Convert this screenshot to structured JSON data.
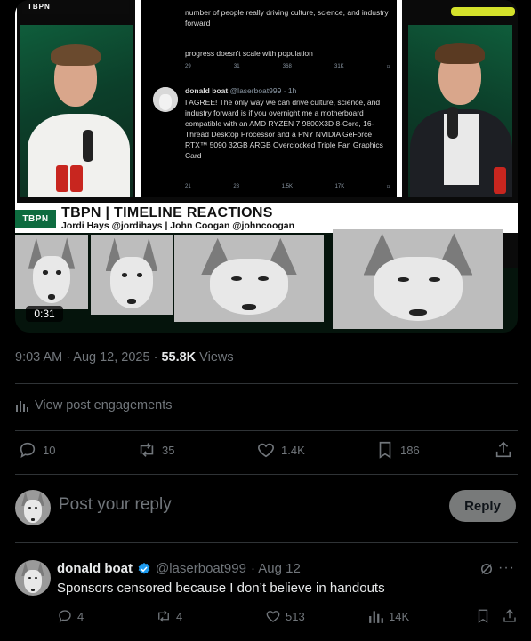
{
  "video": {
    "overlay_tag": "TBPN",
    "embedded_tweet": {
      "top_text": "number of people really driving culture, science, and industry forward",
      "second_line": "progress doesn't scale with population",
      "first_counts": {
        "replies": "29",
        "reposts": "31",
        "likes": "368",
        "views": "31K"
      },
      "author": "donald boat",
      "handle": "@laserboat999 · 1h",
      "body": "I AGREE! The only way we can drive culture, science, and industry forward is if you overnight me a motherboard compatible with an AMD RYZEN 7 9800X3D 8-Core, 16-Thread Desktop Processor and a PNY NVIDIA GeForce RTX™ 5090 32GB ARGB Overclocked Triple Fan Graphics Card",
      "counts": {
        "replies": "21",
        "reposts": "28",
        "likes": "1.5K",
        "views": "17K"
      }
    },
    "lower_third": {
      "logo": "TBPN",
      "title": "TBPN | TIMELINE REACTIONS",
      "subtitle": "Jordi Hays @jordihays | John Coogan @johncoogan"
    },
    "duration": "0:31"
  },
  "post_meta": {
    "time": "9:03 AM · Aug 12, 2025 · ",
    "views_count": "55.8K",
    "views_label": " Views"
  },
  "engagements_label": "View post engagements",
  "actions": {
    "replies": "10",
    "reposts": "35",
    "likes": "1.4K",
    "bookmarks": "186"
  },
  "reply_box": {
    "placeholder": "Post your reply",
    "button": "Reply"
  },
  "comment": {
    "name": "donald boat",
    "handle": "@laserboat999",
    "date": "· Aug 12",
    "text": "Sponsors censored because I don’t believe in handouts",
    "replies": "4",
    "reposts": "4",
    "likes": "513",
    "views": "14K"
  },
  "colors": {
    "background": "#000000",
    "muted": "#71767b",
    "text": "#e7e9ea",
    "verified": "#1d9bf0",
    "lower_third_green": "#0d6b3f"
  }
}
